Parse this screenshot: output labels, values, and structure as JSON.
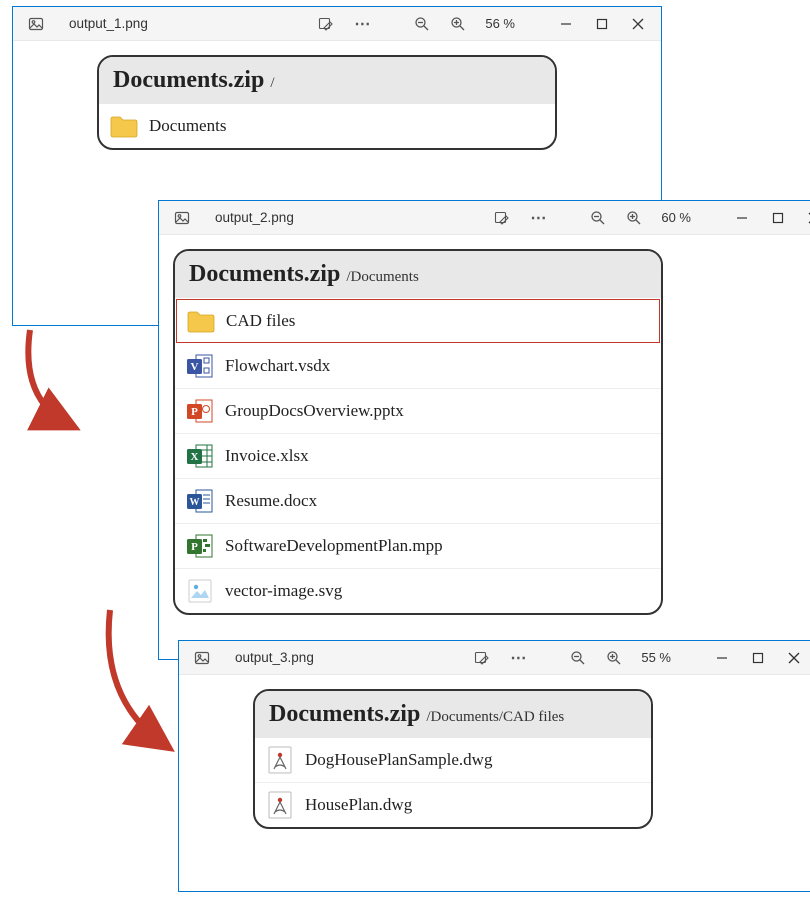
{
  "win1": {
    "filename": "output_1.png",
    "zoom": "56 %",
    "panel": {
      "zipName": "Documents.zip",
      "path": "/",
      "items": [
        {
          "name": "Documents",
          "type": "folder"
        }
      ]
    }
  },
  "win2": {
    "filename": "output_2.png",
    "zoom": "60 %",
    "panel": {
      "zipName": "Documents.zip",
      "path": "/Documents",
      "items": [
        {
          "name": "CAD files",
          "type": "folder",
          "highlighted": true
        },
        {
          "name": "Flowchart.vsdx",
          "type": "visio"
        },
        {
          "name": "GroupDocsOverview.pptx",
          "type": "pptx"
        },
        {
          "name": "Invoice.xlsx",
          "type": "xlsx"
        },
        {
          "name": "Resume.docx",
          "type": "docx"
        },
        {
          "name": "SoftwareDevelopmentPlan.mpp",
          "type": "mpp"
        },
        {
          "name": "vector-image.svg",
          "type": "svg"
        }
      ]
    }
  },
  "win3": {
    "filename": "output_3.png",
    "zoom": "55 %",
    "panel": {
      "zipName": "Documents.zip",
      "path": "/Documents/CAD files",
      "items": [
        {
          "name": "DogHousePlanSample.dwg",
          "type": "dwg"
        },
        {
          "name": "HousePlan.dwg",
          "type": "dwg"
        }
      ]
    }
  }
}
